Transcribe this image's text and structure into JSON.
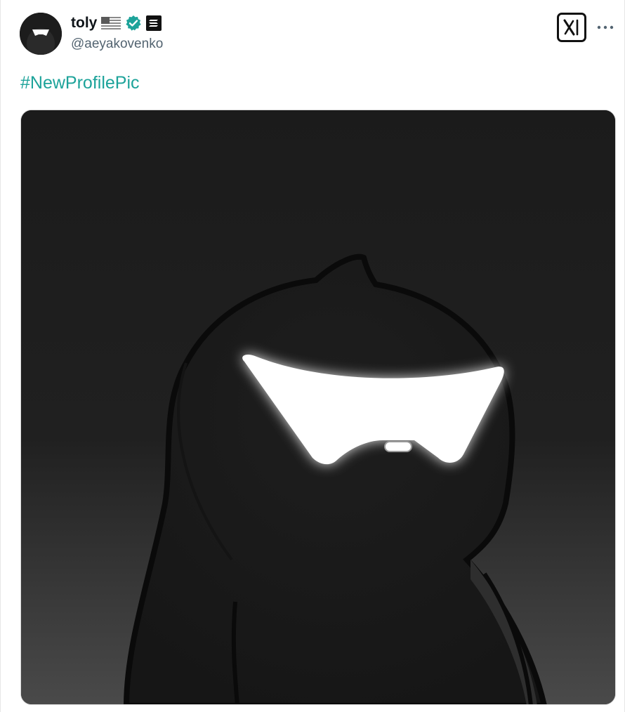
{
  "post": {
    "author": {
      "display_name": "toly",
      "handle": "@aeyakovenko",
      "badges": [
        "us-flag-icon",
        "verified-badge-icon",
        "solana-logo-icon"
      ]
    },
    "hashtag": "#NewProfilePic",
    "media": {
      "description_icon": "profile-picture-image"
    },
    "actions": [
      "x-logo-icon",
      "more-options-icon"
    ]
  },
  "colors": {
    "link": "#1da39a",
    "verified": "#1da39a",
    "text_primary": "#0f1419",
    "text_secondary": "#536471"
  }
}
